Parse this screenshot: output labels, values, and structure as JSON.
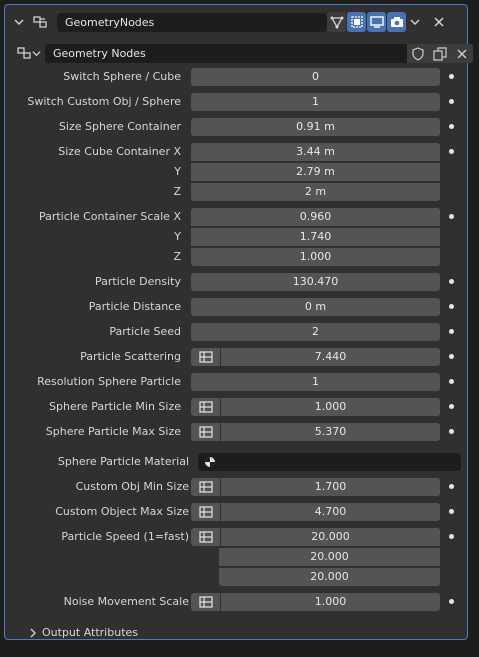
{
  "modifier": {
    "name": "GeometryNodes",
    "node_group": "Geometry Nodes"
  },
  "inputs": [
    {
      "label": "Switch Sphere / Cube",
      "value": "0"
    },
    {
      "label": "Switch Custom Obj / Sphere",
      "value": "1"
    },
    {
      "label": "Size Sphere Container",
      "value": "0.91 m"
    },
    {
      "label": "Size Cube Container X",
      "value": "3.44 m"
    },
    {
      "label": "Y",
      "value": "2.79 m"
    },
    {
      "label": "Z",
      "value": "2 m"
    },
    {
      "label": "Particle Container Scale X",
      "value": "0.960"
    },
    {
      "label": "Y",
      "value": "1.740"
    },
    {
      "label": "Z",
      "value": "1.000"
    },
    {
      "label": "Particle Density",
      "value": "130.470"
    },
    {
      "label": "Particle Distance",
      "value": "0 m"
    },
    {
      "label": "Particle Seed",
      "value": "2"
    },
    {
      "label": "Particle Scattering",
      "value": "7.440"
    },
    {
      "label": "Resolution Sphere Particle",
      "value": "1"
    },
    {
      "label": "Sphere Particle Min Size",
      "value": "1.000"
    },
    {
      "label": "Sphere Particle Max Size",
      "value": "5.370"
    },
    {
      "label": "Sphere Particle Material",
      "value": ""
    },
    {
      "label": "Custom Obj Min Size",
      "value": "1.700"
    },
    {
      "label": "Custom Object Max Size",
      "value": "4.700"
    },
    {
      "label": "Particle Speed (1=fast)",
      "value": "20.000"
    },
    {
      "label": "",
      "value": "20.000"
    },
    {
      "label": "",
      "value": "20.000"
    },
    {
      "label": "Noise Movement Scale",
      "value": "1.000"
    }
  ],
  "footer": {
    "label": "Output Attributes"
  },
  "colors": {
    "accent": "#4772b3",
    "panel": "#303030",
    "field": "#545454"
  }
}
